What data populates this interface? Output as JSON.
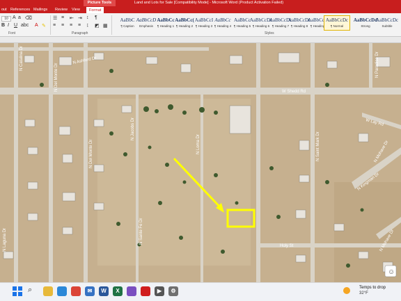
{
  "window": {
    "title": "Land and Lots for Sale [Compatibility Mode] - Microsoft Word (Product Activation Failed)",
    "contextual_tab": "Picture Tools"
  },
  "menu": {
    "tabs": [
      {
        "label": "out"
      },
      {
        "label": "References"
      },
      {
        "label": "Mailings"
      },
      {
        "label": "Review"
      },
      {
        "label": "View"
      },
      {
        "label": "Format"
      }
    ]
  },
  "ribbon": {
    "font_size": "10",
    "groups": {
      "font": "Font",
      "paragraph": "Paragraph",
      "styles": "Styles"
    },
    "styles": [
      {
        "sample": "AaBbC",
        "name": "¶ Caption"
      },
      {
        "sample": "AaBbCcD",
        "name": "Emphasis"
      },
      {
        "sample": "AaBbCc",
        "name": "¶ Heading 1"
      },
      {
        "sample": "AaBbCc(",
        "name": "¶ Heading 2"
      },
      {
        "sample": "AaBbCcI",
        "name": "¶ Heading 3"
      },
      {
        "sample": "AaBbCc",
        "name": "¶ Heading 4"
      },
      {
        "sample": "AaBbCc",
        "name": "¶ Heading 5"
      },
      {
        "sample": "AaBbCcDc",
        "name": "¶ Heading 6"
      },
      {
        "sample": "AaBbCcDc",
        "name": "¶ Heading 7"
      },
      {
        "sample": "AaBbCcDc",
        "name": "¶ Heading 8"
      },
      {
        "sample": "AaBbCcDc",
        "name": "¶ Heading 9"
      },
      {
        "sample": "AaBbCcDc",
        "name": "¶ Normal",
        "selected": true
      },
      {
        "sample": "AaBbCcDd",
        "name": "Strong"
      },
      {
        "sample": "AaBbCcDc",
        "name": "Subtitle"
      }
    ]
  },
  "map": {
    "streets": {
      "shedd": "W Shedd Rd",
      "holy": "Holy St",
      "catalina": "N Catalina Dr",
      "del_monte": "N Del Monte Dr",
      "jacobs": "N Jacobs Dr",
      "loma": "N Loma Dr",
      "sante_fe": "N Sante Fe Dr",
      "saint_mark": "N Saint Mark Dr",
      "ashford": "N Ashford Dr",
      "paradise": "N Paradise Dr",
      "laguna": "N Laguna Dr",
      "kingman": "N Kingman Dr",
      "mohave": "N Mohave Dr",
      "mohave_tr": "N Mohave Dr",
      "lay": "W Lay Rd"
    },
    "highlight_color": "#ffff00",
    "road_color": "#d9d3c7"
  },
  "taskbar": {
    "apps": [
      {
        "name": "explorer-app",
        "color": "#e7b93a"
      },
      {
        "name": "edge-app",
        "color": "#2b88d8"
      },
      {
        "name": "chrome-app",
        "color": "#db4437"
      },
      {
        "name": "mail-app",
        "color": "#3672c3"
      },
      {
        "name": "word-app",
        "color": "#2a579a",
        "glyph": "W"
      },
      {
        "name": "excel-app",
        "color": "#1f7244",
        "glyph": "X"
      },
      {
        "name": "photos-app",
        "color": "#7a4fc0"
      },
      {
        "name": "acrobat-app",
        "color": "#d01d1d"
      },
      {
        "name": "media-app",
        "color": "#555555"
      },
      {
        "name": "settings-app",
        "color": "#6f6f6f"
      }
    ],
    "weather": {
      "temp": "Temps to drop",
      "desc": "32°F"
    }
  }
}
